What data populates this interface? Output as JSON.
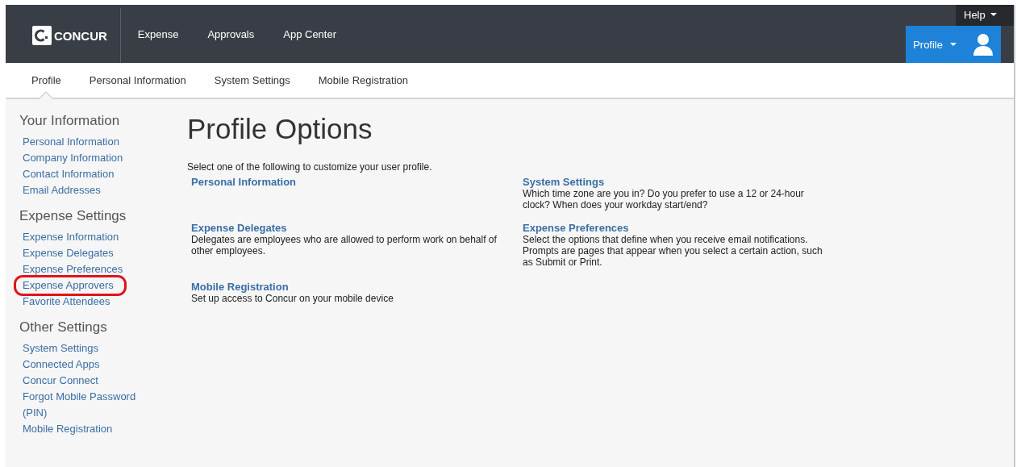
{
  "header": {
    "logo": "CONCUR",
    "nav": [
      "Expense",
      "Approvals",
      "App Center"
    ],
    "help": "Help",
    "profile": "Profile"
  },
  "subnav": [
    {
      "label": "Profile",
      "selected": true
    },
    {
      "label": "Personal Information",
      "selected": false
    },
    {
      "label": "System Settings",
      "selected": false
    },
    {
      "label": "Mobile Registration",
      "selected": false
    }
  ],
  "sidebar": [
    {
      "heading": "Your Information",
      "items": [
        {
          "label": "Personal Information",
          "circled": false
        },
        {
          "label": "Company Information",
          "circled": false
        },
        {
          "label": "Contact Information",
          "circled": false
        },
        {
          "label": "Email Addresses",
          "circled": false
        }
      ]
    },
    {
      "heading": "Expense Settings",
      "items": [
        {
          "label": "Expense Information",
          "circled": false
        },
        {
          "label": "Expense Delegates",
          "circled": false
        },
        {
          "label": "Expense Preferences",
          "circled": false
        },
        {
          "label": "Expense Approvers",
          "circled": true
        },
        {
          "label": "Favorite Attendees",
          "circled": false
        }
      ]
    },
    {
      "heading": "Other Settings",
      "items": [
        {
          "label": "System Settings",
          "circled": false
        },
        {
          "label": "Connected Apps",
          "circled": false
        },
        {
          "label": "Concur Connect",
          "circled": false
        },
        {
          "label": "Forgot Mobile Password (PIN)",
          "circled": false
        },
        {
          "label": "Mobile Registration",
          "circled": false
        }
      ]
    }
  ],
  "main": {
    "title": "Profile Options",
    "intro": "Select one of the following to customize your user profile.",
    "option_rows": [
      [
        {
          "title": "Personal Information"
        },
        {
          "title": "System Settings",
          "description": "Which time zone are you in? Do you prefer to use a 12 or 24-hour clock? When does your workday start/end?"
        }
      ],
      [
        {
          "title": "Expense Delegates",
          "description": "Delegates are employees who are allowed to perform work on behalf of other employees."
        },
        {
          "title": "Expense Preferences",
          "description": "Select the options that define when you receive email notifications. Prompts are pages that appear when you select a certain action, such as Submit or Print."
        }
      ],
      [
        {
          "title": "Mobile Registration",
          "description": "Set up access to Concur on your mobile device"
        }
      ]
    ]
  }
}
